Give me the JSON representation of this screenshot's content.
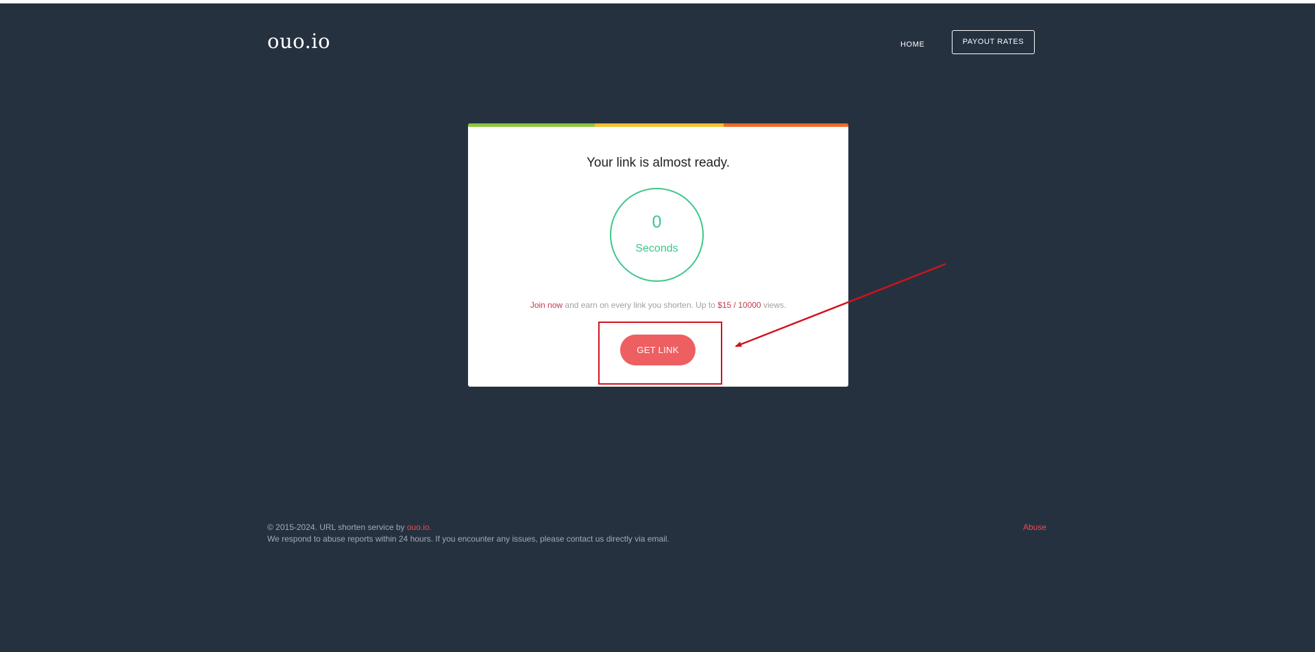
{
  "header": {
    "logo": "ouo.io",
    "nav": {
      "home": "HOME",
      "payout_rates": "PAYOUT RATES"
    }
  },
  "card": {
    "title": "Your link is almost ready.",
    "countdown": {
      "value": "0",
      "unit": "Seconds"
    },
    "promo": {
      "join": "Join now",
      "middle": " and earn on every link you shorten. Up to ",
      "rate": "$15 / 10000",
      "end": " views."
    },
    "button": "GET LINK",
    "bar_colors": [
      "#8cc63f",
      "#f4c02c",
      "#f06a29"
    ]
  },
  "footer": {
    "copyright_prefix": "© 2015-2024. URL shorten service by ",
    "brand": "ouo.io.",
    "note": "We respond to abuse reports within 24 hours. If you encounter any issues, please contact us directly via email.",
    "abuse": "Abuse"
  },
  "colors": {
    "background": "#263140",
    "accent_green": "#3cc68a",
    "button": "#ee5f61",
    "annotation_red": "#d0121c"
  }
}
